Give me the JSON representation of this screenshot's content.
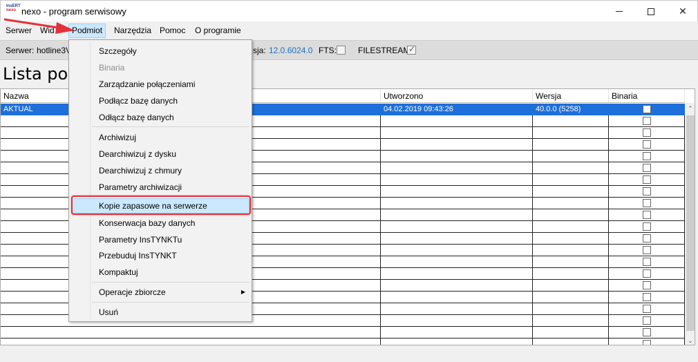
{
  "window": {
    "title": "nexo - program serwisowy",
    "logo_top": "InsERT",
    "logo_bottom": "nexo"
  },
  "menubar": {
    "items": [
      "Serwer",
      "Wid",
      "Podmiot",
      "Narzędzia",
      "Pomoc",
      "O programie"
    ],
    "active": "Podmiot"
  },
  "infobar": {
    "server_label": "Serwer:",
    "server_value": "hotline3V",
    "version_label": "sja:",
    "version_value": "12.0.6024.0",
    "fts_label": "FTS:",
    "fts_checked": false,
    "filestream_label": "FILESTREAM:",
    "filestream_checked": true
  },
  "heading": "Lista pod",
  "table": {
    "columns": [
      "Nazwa",
      "Utworzono",
      "Wersja",
      "Binaria"
    ],
    "rows": [
      {
        "name": "AKTUAL",
        "created": "04.02.2019 09:43:26",
        "version": "40.0.0 (5258)",
        "binaria": false,
        "selected": true
      }
    ],
    "empty_rows": 20
  },
  "dropdown": {
    "items": [
      {
        "label": "Szczegóły",
        "disabled": false
      },
      {
        "label": "Binaria",
        "disabled": true
      },
      {
        "label": "Zarządzanie połączeniami",
        "disabled": false
      },
      {
        "label": "Podłącz bazę danych",
        "disabled": false
      },
      {
        "label": "Odłącz bazę danych",
        "disabled": false
      },
      {
        "label": "Archiwizuj",
        "disabled": false
      },
      {
        "label": "Dearchiwizuj z dysku",
        "disabled": false
      },
      {
        "label": "Dearchiwizuj z chmury",
        "disabled": false
      },
      {
        "label": "Parametry archiwizacji",
        "disabled": false
      },
      {
        "label": "Kopie zapasowe na serwerze",
        "disabled": false,
        "hover": true
      },
      {
        "label": "Konserwacja bazy danych",
        "disabled": false
      },
      {
        "label": "Parametry InsTYNKTu",
        "disabled": false
      },
      {
        "label": "Przebuduj InsTYNKT",
        "disabled": false
      },
      {
        "label": "Kompaktuj",
        "disabled": false
      },
      {
        "label": "Operacje zbiorcze",
        "disabled": false,
        "submenu": true
      },
      {
        "label": "Usuń",
        "disabled": false
      }
    ]
  },
  "colors": {
    "selection": "#1e6fd9",
    "hover": "#cce8ff",
    "highlight_border": "#e53039",
    "arrow": "#e53039"
  }
}
